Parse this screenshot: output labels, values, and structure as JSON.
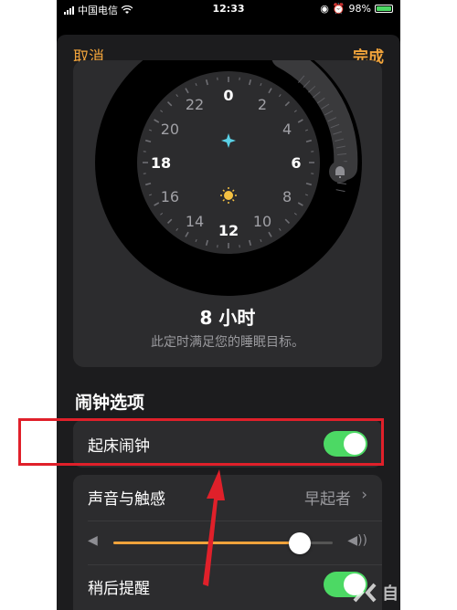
{
  "status_bar": {
    "carrier": "中国电信",
    "time": "12:33",
    "battery": "98%"
  },
  "nav": {
    "cancel": "取消",
    "done": "完成"
  },
  "clock": {
    "hour_labels": [
      "0",
      "2",
      "4",
      "6",
      "8",
      "10",
      "12",
      "14",
      "16",
      "18",
      "20",
      "22"
    ],
    "duration": "8 小时",
    "hint": "此定时满足您的睡眠目标。"
  },
  "alarm_options": {
    "title": "闹钟选项",
    "wake_alarm": "起床闹钟",
    "sound_haptics": "声音与触感",
    "sound_value": "早起者",
    "snooze": "稍后提醒",
    "volume_level": 0.85
  },
  "colors": {
    "accent": "#f0a33b",
    "toggle_on": "#4cd964",
    "highlight": "#e0202a"
  },
  "watermark": "自由互联"
}
